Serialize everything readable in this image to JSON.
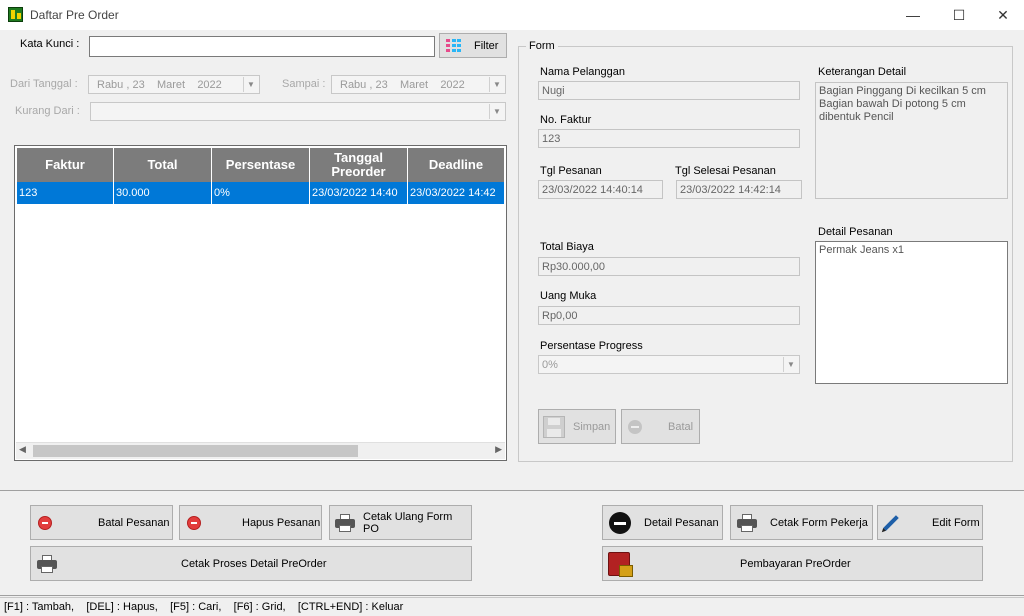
{
  "window": {
    "title": "Daftar Pre Order",
    "minimize": "—",
    "maximize": "☐",
    "close": "✕"
  },
  "search": {
    "label": "Kata Kunci :",
    "value": "",
    "filter_label": "Filter"
  },
  "date_filter": {
    "from_label": "Dari Tanggal :",
    "from_day": "Rabu",
    "from_date": "23",
    "from_month": "Maret",
    "from_year": "2022",
    "to_label": "Sampai :",
    "to_day": "Rabu",
    "to_date": "23",
    "to_month": "Maret",
    "to_year": "2022",
    "less_label": "Kurang Dari :"
  },
  "grid": {
    "columns": [
      "Faktur",
      "Total",
      "Persentase",
      "Tanggal Preorder",
      "Deadline"
    ],
    "rows": [
      {
        "faktur": "123",
        "total": "30.000",
        "persentase": "0%",
        "tanggal": "23/03/2022 14:40",
        "deadline": "23/03/2022 14:42"
      }
    ]
  },
  "form": {
    "legend": "Form",
    "nama_pelanggan_label": "Nama Pelanggan",
    "nama_pelanggan": "Nugi",
    "no_faktur_label": "No. Faktur",
    "no_faktur": "123",
    "tgl_pesanan_label": "Tgl Pesanan",
    "tgl_pesanan": "23/03/2022 14:40:14",
    "tgl_selesai_label": "Tgl Selesai Pesanan",
    "tgl_selesai": "23/03/2022 14:42:14",
    "total_biaya_label": "Total Biaya",
    "total_biaya": "Rp30.000,00",
    "uang_muka_label": "Uang Muka",
    "uang_muka": "Rp0,00",
    "progress_label": "Persentase Progress",
    "progress": "0%",
    "keterangan_label": "Keterangan Detail",
    "keterangan": "Bagian Pinggang Di kecilkan 5 cm\nBagian bawah Di potong 5 cm\ndibentuk Pencil",
    "detail_label": "Detail Pesanan",
    "detail": "Permak Jeans x1",
    "simpan": "Simpan",
    "batal": "Batal"
  },
  "actions": {
    "batal_pesanan": "Batal Pesanan",
    "hapus_pesanan": "Hapus Pesanan",
    "cetak_ulang": "Cetak Ulang Form PO",
    "cetak_proses": "Cetak Proses Detail PreOrder",
    "detail_pesanan": "Detail Pesanan",
    "cetak_form_pekerja": "Cetak Form Pekerja",
    "edit_form": "Edit Form",
    "pembayaran": "Pembayaran PreOrder"
  },
  "status": "[F1] : Tambah,    [DEL] : Hapus,    [F5] : Cari,    [F6] : Grid,    [CTRL+END] : Keluar",
  "colors": {
    "selection": "#0078d7",
    "header": "#7c7c7c"
  }
}
